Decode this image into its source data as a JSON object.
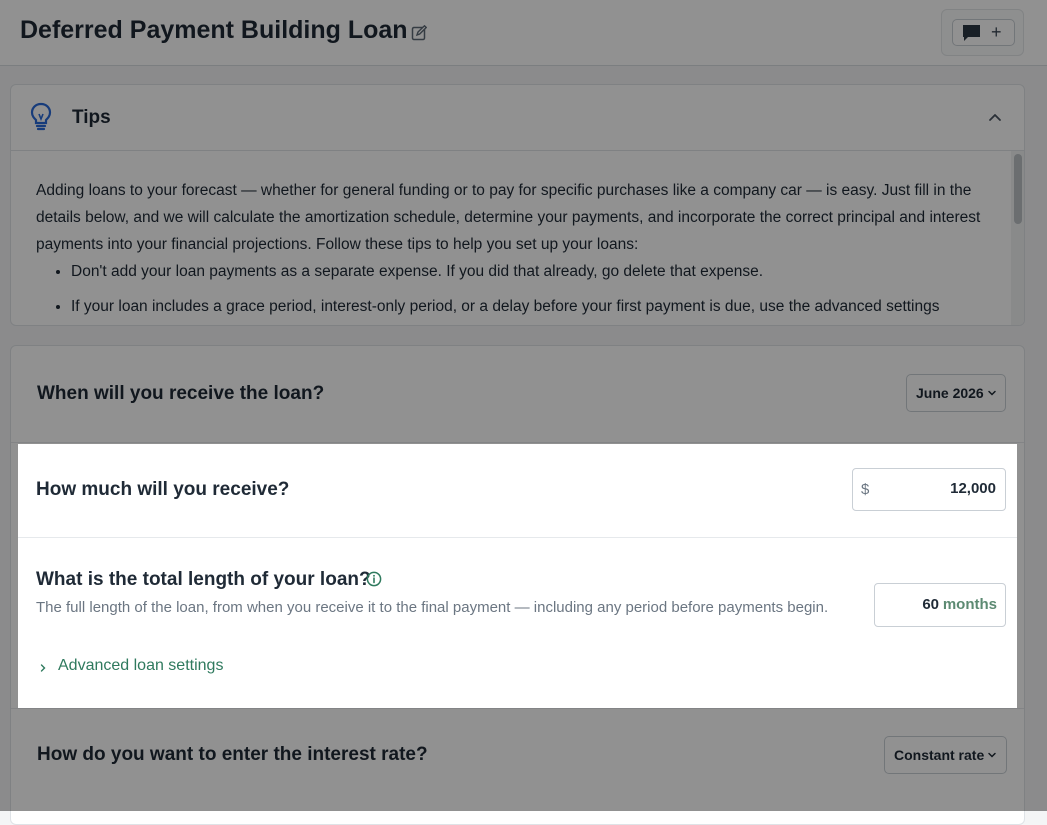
{
  "header": {
    "title": "Deferred Payment Building Loan",
    "comment_plus": "+"
  },
  "tips": {
    "title": "Tips",
    "intro": "Adding loans to your forecast — whether for general funding or to pay for specific purchases like a company car — is easy. Just fill in the details below, and we will calculate the amortization schedule, determine your payments, and incorporate the correct principal and interest payments into your financial projections. Follow these tips to help you set up your loans:",
    "bullets": [
      "Don't add your loan payments as a separate expense. If you did that already, go delete that expense.",
      "If your loan includes a grace period, interest-only period, or a delay before your first payment is due, use the advanced settings"
    ]
  },
  "form": {
    "receive_date": {
      "question": "When will you receive the loan?",
      "value": "June 2026"
    },
    "amount": {
      "question": "How much will you receive?",
      "prefix": "$",
      "value": "12,000"
    },
    "length": {
      "question": "What is the total length of your loan?",
      "helper": "The full length of the loan, from when you receive it to the final payment — including any period before payments begin.",
      "value": "60",
      "unit": "months",
      "advanced_link": "Advanced loan settings"
    },
    "interest": {
      "question": "How do you want to enter the interest rate?",
      "value": "Constant rate"
    }
  },
  "colors": {
    "accent_green": "#2f7a5e",
    "tip_icon_blue": "#2a6ad8",
    "overlay": "rgba(0,0,0,0.43)"
  },
  "icons": [
    "edit-icon",
    "comment-icon",
    "plus-icon",
    "lightbulb-icon",
    "chevron-up-icon",
    "chevron-down-icon",
    "info-icon",
    "chevron-right-icon"
  ]
}
